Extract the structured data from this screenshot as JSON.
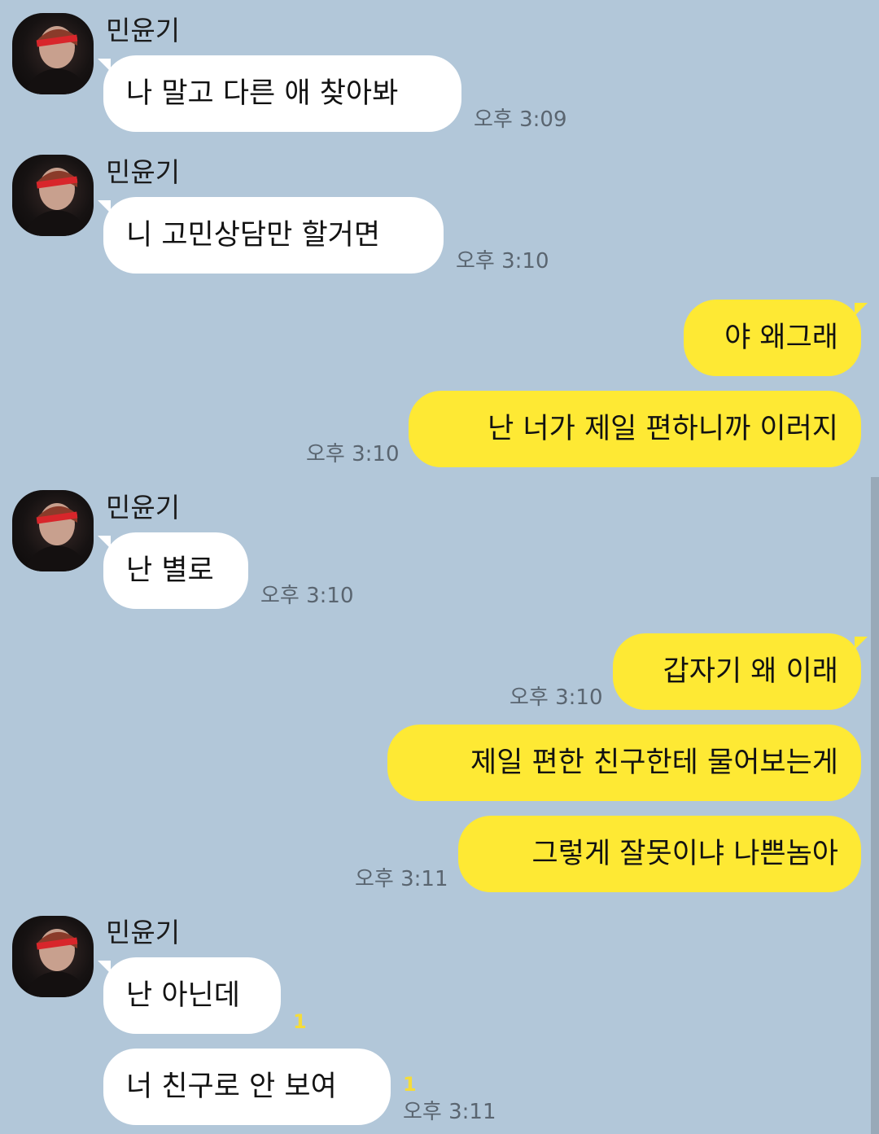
{
  "chat": {
    "messages": [
      {
        "sender": "민윤기",
        "text": "나 말고 다른 애 찾아봐",
        "time": "오후 3:09"
      },
      {
        "sender": "민윤기",
        "text": "니 고민상담만 할거면",
        "time": "오후 3:10"
      },
      {
        "from": "me",
        "text": "야 왜그래"
      },
      {
        "from": "me",
        "text": "난 너가 제일 편하니까 이러지",
        "time": "오후 3:10"
      },
      {
        "sender": "민윤기",
        "text": "난 별로",
        "time": "오후 3:10"
      },
      {
        "from": "me",
        "text": "갑자기 왜 이래",
        "time": "오후 3:10"
      },
      {
        "from": "me",
        "text": "제일 편한 친구한테 물어보는게"
      },
      {
        "from": "me",
        "text": "그렇게 잘못이냐 나쁜놈아",
        "time": "오후 3:11"
      },
      {
        "sender": "민윤기",
        "text": "난 아닌데",
        "unread": "1"
      },
      {
        "sender": "민윤기",
        "text": "너 친구로 안 보여",
        "unread": "1",
        "time": "오후 3:11"
      }
    ]
  },
  "colors": {
    "background": "#b2c7d9",
    "incoming_bubble": "#ffffff",
    "outgoing_bubble": "#fee934",
    "unread_count": "#f5dc3a"
  },
  "icons": {
    "avatar": "profile-photo"
  }
}
